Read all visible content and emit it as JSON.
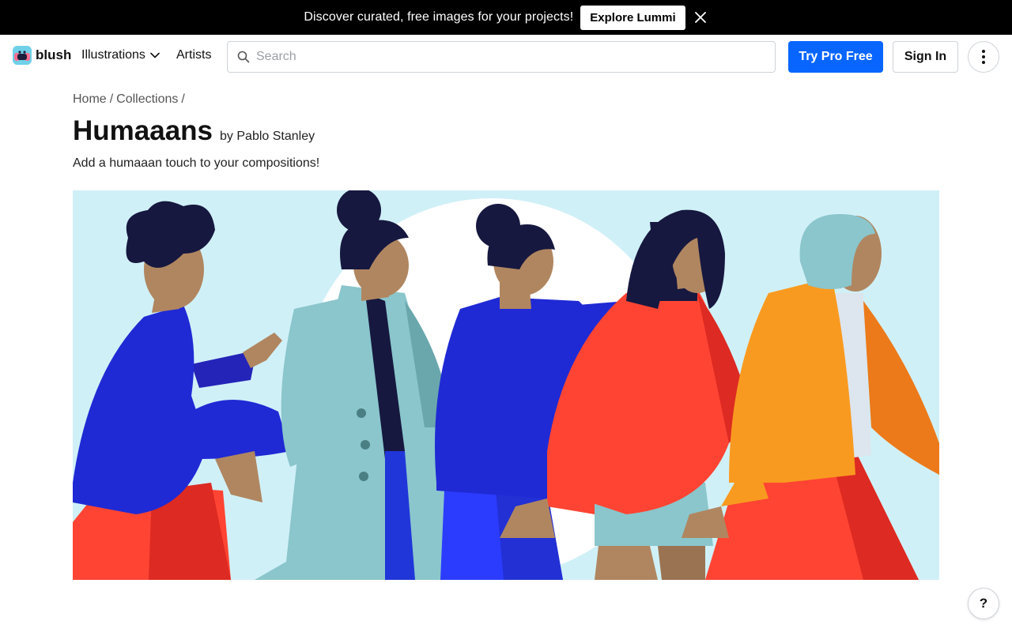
{
  "promo": {
    "text": "Discover curated, free images for your projects!",
    "button_label": "Explore Lummi",
    "close_icon": "close-icon"
  },
  "header": {
    "logo_text": "blush",
    "nav": {
      "illustrations_label": "Illustrations",
      "artists_label": "Artists"
    },
    "search": {
      "placeholder": "Search",
      "value": ""
    },
    "try_pro_label": "Try Pro Free",
    "sign_in_label": "Sign In",
    "more_icon": "more-vertical-icon"
  },
  "breadcrumb": {
    "items": [
      "Home",
      "/",
      "Collections",
      "/"
    ]
  },
  "collection": {
    "title": "Humaaans",
    "byline": "by Pablo Stanley",
    "description": "Add a humaaan touch to your compositions!"
  },
  "help_label": "?",
  "colors": {
    "primary": "#0866ff",
    "hero_bg": "#d0f0f7",
    "banner_bg": "#000000"
  }
}
